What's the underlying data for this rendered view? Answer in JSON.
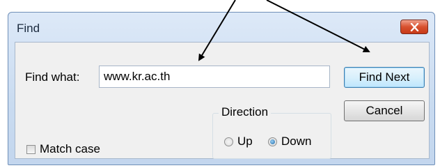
{
  "window": {
    "title": "Find"
  },
  "find": {
    "label": "Find what:",
    "value": "www.kr.ac.th"
  },
  "buttons": {
    "find_next": "Find Next",
    "cancel": "Cancel"
  },
  "direction": {
    "title": "Direction",
    "up": "Up",
    "down": "Down",
    "selected": "Down"
  },
  "match_case": {
    "label": "Match case",
    "checked": false
  },
  "icons": [
    "close-icon"
  ],
  "colors": {
    "close": "#d8512f",
    "frame": "#c9dbf0",
    "client": "#f0f0f0"
  }
}
